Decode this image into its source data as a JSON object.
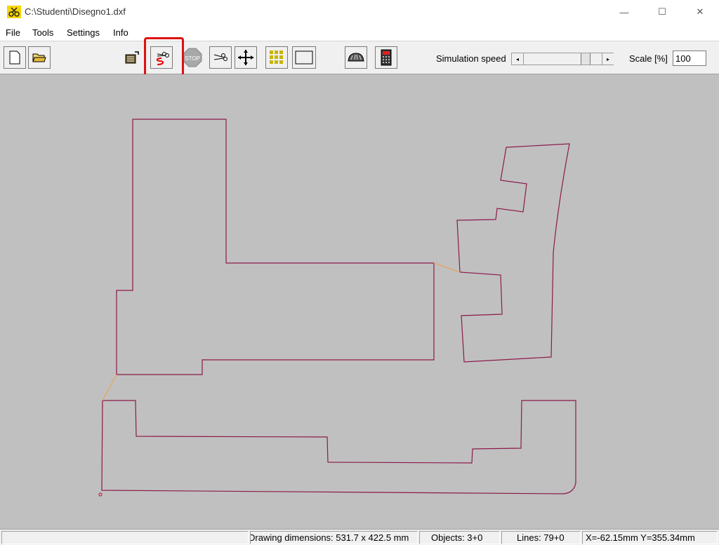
{
  "window": {
    "title": "C:\\Studenti\\Disegno1.dxf",
    "minimize_glyph": "—",
    "maximize_glyph": "☐",
    "close_glyph": "✕"
  },
  "menu": [
    "File",
    "Tools",
    "Settings",
    "Info"
  ],
  "toolbar": {
    "buttons": [
      "new-file-icon",
      "open-folder-icon",
      "export-gcode-icon",
      "cut-simulation-icon",
      "stop-icon",
      "cut-icon",
      "move-icon",
      "grid-icon",
      "rectangle-icon",
      "cutter-head-icon",
      "controller-device-icon"
    ],
    "stop_text": "STOP",
    "simulation_speed_label": "Simulation speed",
    "scroll_left": "◂",
    "scroll_right": "▸",
    "scale_label": "Scale [%]",
    "scale_value": "100"
  },
  "colors": {
    "canvas": "#c0c0c0",
    "path": "#8b1a4a",
    "connector": "#e8a55a",
    "highlight": "#dd1111"
  },
  "status": {
    "empty": "",
    "drawing_dimensions": "Drawing dimensions: 531.7 x 422.5 mm",
    "objects": "Objects: 3+0",
    "lines": "Lines: 79+0",
    "coordinates": "X=-62.15mm Y=355.34mm"
  }
}
